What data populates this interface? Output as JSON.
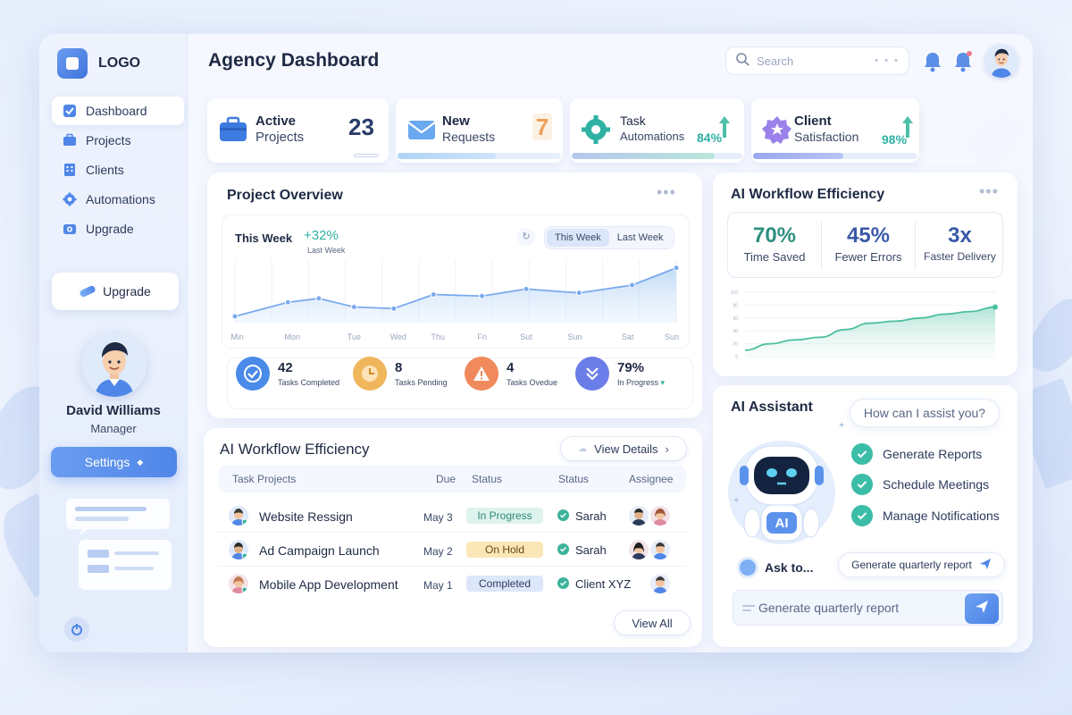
{
  "app": {
    "logo_text": "LOGO",
    "page_title": "Agency Dashboard"
  },
  "sidebar": {
    "items": [
      {
        "label": "Dashboard",
        "icon": "checkbox-icon",
        "active": true
      },
      {
        "label": "Projects",
        "icon": "briefcase-icon"
      },
      {
        "label": "Clients",
        "icon": "building-icon"
      },
      {
        "label": "Automations",
        "icon": "gear-icon"
      },
      {
        "label": "Upgrade",
        "icon": "camera-icon"
      }
    ],
    "upgrade_button": "Upgrade",
    "user": {
      "name": "David Williams",
      "role": "Manager"
    },
    "settings_button": "Settings"
  },
  "header": {
    "search_placeholder": "Search"
  },
  "stats": [
    {
      "line1": "Active",
      "line2": "Projects",
      "value": "23",
      "icon": "briefcase-icon",
      "color": "#3d7be0"
    },
    {
      "line1": "New",
      "line2": "Requests",
      "value": "7",
      "icon": "envelope-icon",
      "color": "#f0a05a",
      "progress": 0.6
    },
    {
      "line1": "Task",
      "line2": "Automations",
      "value": "84%",
      "icon": "gear-icon",
      "color": "#2fb1a3",
      "progress": 0.84
    },
    {
      "line1": "Client",
      "line2": "Satisfaction",
      "value": "98%",
      "icon": "star-badge-icon",
      "color": "#8b6fe8",
      "progress": 0.55
    }
  ],
  "overview": {
    "title": "Project Overview",
    "period_label": "This Week",
    "change": "+32%",
    "change_sub": "Last Week",
    "toggle": [
      "This Week",
      "Last Week"
    ],
    "task_stats": [
      {
        "value": "42",
        "label": "Tasks Completed",
        "icon": "check-icon",
        "color": "#4a8ae8"
      },
      {
        "value": "8",
        "label": "Tasks Pending",
        "icon": "clock-icon",
        "color": "#f0b65c"
      },
      {
        "value": "4",
        "label": "Tasks Ovedue",
        "icon": "warning-icon",
        "color": "#f08a5c"
      },
      {
        "value": "79%",
        "label": "In Progress",
        "icon": "double-chevron-icon",
        "color": "#6a7de8"
      }
    ]
  },
  "chart_data": [
    {
      "type": "area",
      "title": "Project Overview",
      "x": [
        "Min",
        "Mon",
        "Tue",
        "Wed",
        "Thu",
        "Fri",
        "Sut",
        "Sun",
        "Sat",
        "Sun"
      ],
      "values": [
        8,
        26,
        31,
        20,
        18,
        36,
        34,
        43,
        38,
        48,
        70
      ],
      "x_positions": [
        0,
        0.12,
        0.19,
        0.27,
        0.36,
        0.45,
        0.56,
        0.66,
        0.78,
        0.9,
        1.0
      ],
      "ylim": [
        0,
        80
      ],
      "grid": true
    },
    {
      "type": "area",
      "title": "AI Workflow Efficiency",
      "y_ticks": [
        "0",
        "20",
        "40",
        "60",
        "80",
        "100"
      ],
      "values": [
        10,
        20,
        26,
        30,
        42,
        52,
        55,
        60,
        66,
        70,
        77
      ],
      "ylim": [
        0,
        100
      ]
    }
  ],
  "workflow_table": {
    "title": "AI Workflow Efficiency",
    "view_details": "View Details",
    "headers": [
      "Task Projects",
      "Due",
      "Status",
      "Status",
      "Assignee"
    ],
    "rows": [
      {
        "name": "Website Ressign",
        "due": "May 3",
        "status": "In Progress",
        "status_color": "#dff3ee",
        "status_text_color": "#2a8a78",
        "owner": "Sarah"
      },
      {
        "name": "Ad Campaign Launch",
        "due": "May 2",
        "status": "On Hold",
        "status_color": "#fbe6b8",
        "status_text_color": "#6b4a12",
        "owner": "Sarah"
      },
      {
        "name": "Mobile App Development",
        "due": "May 1",
        "status": "Completed",
        "status_color": "#dde7fa",
        "status_text_color": "#2c3a5c",
        "owner": "Client XYZ"
      }
    ],
    "view_all": "View All"
  },
  "efficiency": {
    "title": "AI Workflow Efficiency",
    "metrics": [
      {
        "value": "70%",
        "label": "Time Saved",
        "color": "#2f8f80"
      },
      {
        "value": "45%",
        "label": "Fewer Errors",
        "color": "#3a5aa8"
      },
      {
        "value": "3x",
        "label": "Faster Delivery",
        "color": "#3a5aa8"
      }
    ]
  },
  "assistant": {
    "title": "AI Assistant",
    "bubble": "How can I assist you?",
    "options": [
      "Generate Reports",
      "Schedule Meetings",
      "Manage Notifications"
    ],
    "robot_badge": "AI",
    "ask_label": "Ask to...",
    "suggestion": "Generate quarterly report",
    "input_value": "Generate quarterly report"
  }
}
